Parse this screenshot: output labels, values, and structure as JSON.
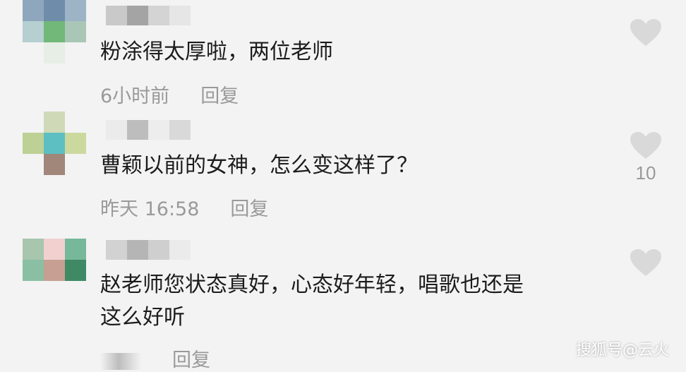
{
  "comments": [
    {
      "text": "粉涂得太厚啦，两位老师",
      "time": "6小时前",
      "reply_label": "回复",
      "likes": ""
    },
    {
      "text": "曹颖以前的女神，怎么变这样了？",
      "time": "昨天 16:58",
      "reply_label": "回复",
      "likes": "10"
    },
    {
      "text_line1": "赵老师您状态真好，心态好年轻，唱歌也还是",
      "text_line2": "这么好听",
      "time": "",
      "reply_label": "回复",
      "likes": ""
    }
  ],
  "watermark": "搜狐号@云火",
  "colors": {
    "text": "#1c1c1c",
    "meta": "#9a9a9a",
    "heart": "#d9d9d9",
    "background": "#f3f3f3"
  },
  "icons": [
    "heart-icon"
  ]
}
